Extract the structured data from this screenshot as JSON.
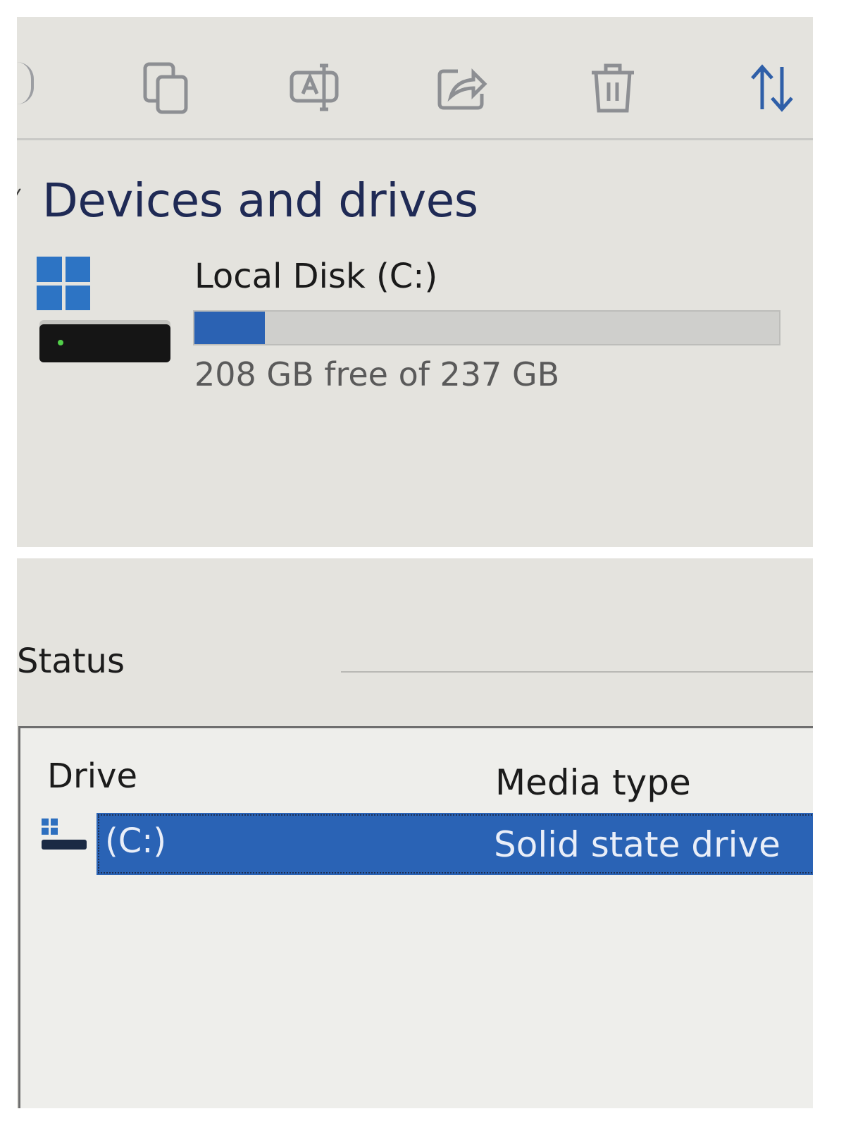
{
  "toolbar": {
    "icons": [
      "copy-icon",
      "rename-icon",
      "share-icon",
      "delete-icon",
      "sort-icon"
    ]
  },
  "devices": {
    "section_title": "Devices and drives",
    "drive": {
      "label": "Local Disk (C:)",
      "free_text": "208 GB free of 237 GB",
      "used_fraction": 0.12,
      "bar_color": "#2b62b3"
    }
  },
  "status": {
    "label": "Status"
  },
  "drive_list": {
    "columns": [
      "Drive",
      "Media type"
    ],
    "rows": [
      {
        "drive": "(C:)",
        "media_type": "Solid state drive",
        "selected": true
      }
    ],
    "selection_color": "#2a63b5"
  }
}
